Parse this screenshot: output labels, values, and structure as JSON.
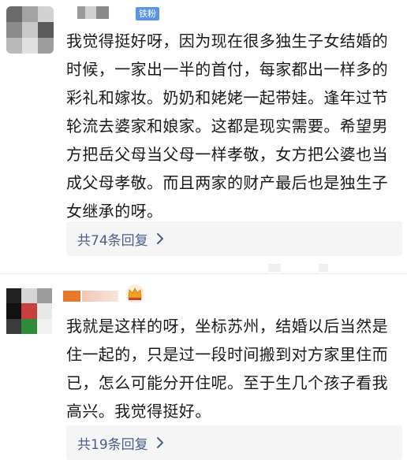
{
  "comments": [
    {
      "badge": "铁粉",
      "text": "我觉得挺好呀，因为现在很多独生子女结婚的时候，一家出一半的首付，每家都出一样多的彩礼和嫁妆。奶奶和姥姥一起带娃。逢年过节轮流去婆家和娘家。这都是现实需要。希望男方把岳父母当父母一样孝敬，女方把公婆也当成父母孝敬。而且两家的财产最后也是独生子女继承的呀。",
      "reply_label": "共74条回复",
      "avatar_colors": [
        "#6b6b6b",
        "#a3a3a3",
        "#d2d2d2",
        "#8c8c8c",
        "#c9c9c9",
        "#5a5a5a",
        "#b9b9b9",
        "#e0e0e0",
        "#9d9d9d"
      ]
    },
    {
      "text": "我就是这样的呀，坐标苏州，结婚以后当然是住一起的，只是过一段时间搬到对方家里住而已，怎么可能分开住呢。至于生几个孩子看我高兴。我觉得挺好。",
      "reply_label": "共19条回复",
      "avatar_colors": [
        "#222222",
        "#d6d6d6",
        "#9c9c9c",
        "#111111",
        "#c93f3f",
        "#e8e8e8",
        "#3b3b3b",
        "#2e8b3a",
        "#f2f2f2"
      ]
    }
  ],
  "icons": {
    "reply_chevron": "chevron-right-icon",
    "vip": "crown-icon"
  },
  "colors": {
    "reply_text": "#4b5f86",
    "badge": "#5d93e3",
    "crown": "#f0a31b"
  }
}
